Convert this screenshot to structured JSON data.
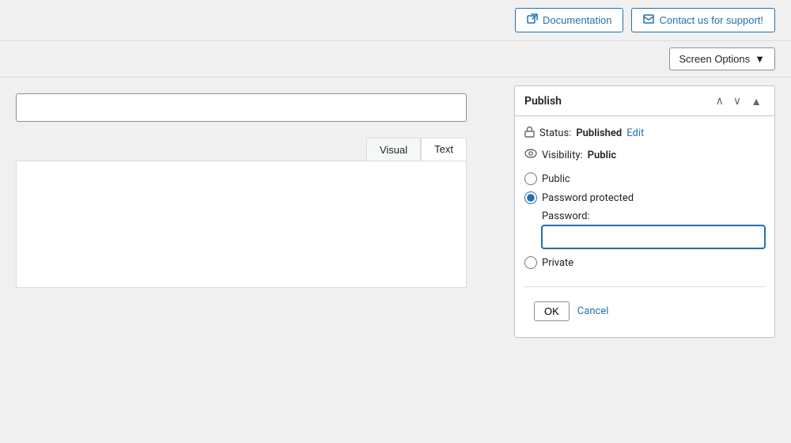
{
  "topbar": {
    "documentation_label": "Documentation",
    "support_label": "Contact us for support!"
  },
  "screen_options": {
    "label": "Screen Options"
  },
  "editor": {
    "title_placeholder": "",
    "tab_visual": "Visual",
    "tab_text": "Text"
  },
  "publish": {
    "title": "Publish",
    "status_label": "Status:",
    "status_value": "Published",
    "status_edit": "Edit",
    "visibility_label": "Visibility:",
    "visibility_value": "Public",
    "option_public": "Public",
    "option_password": "Password protected",
    "option_private": "Private",
    "password_label": "Password:",
    "ok_label": "OK",
    "cancel_label": "Cancel"
  },
  "icons": {
    "external_link": "⬡",
    "envelope": "✉",
    "chevron_down": "▼",
    "chevron_up": "∧",
    "chevron_down_small": "∨",
    "arrow_up": "▲",
    "lock": "🔒",
    "eye": "👁"
  }
}
